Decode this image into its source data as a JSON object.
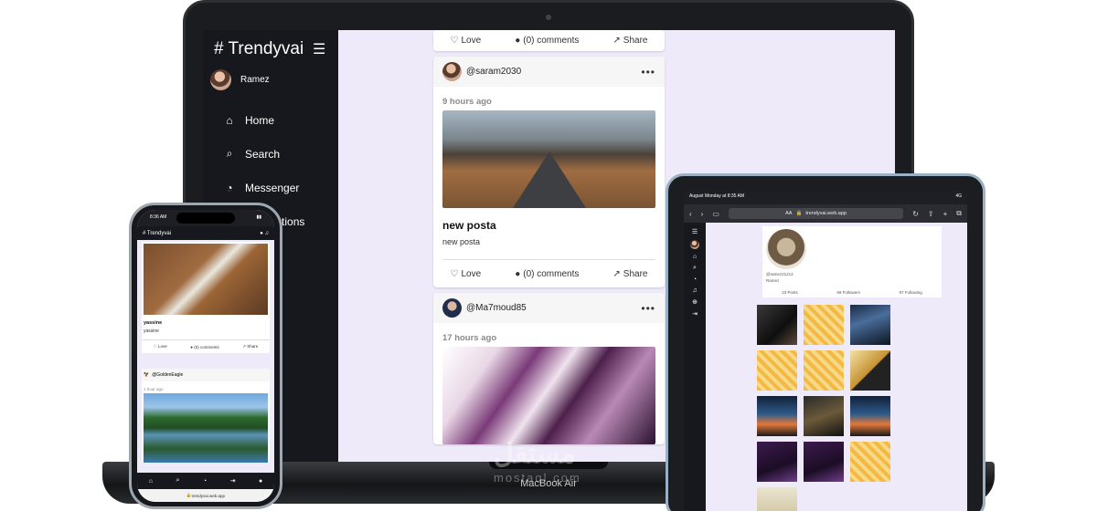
{
  "laptop": {
    "brand": "# Trendyvai",
    "menu_icon": "hamburger-icon",
    "user_name": "Ramez",
    "nav": [
      {
        "icon": "home-icon",
        "glyph": "⌂",
        "label": "Home"
      },
      {
        "icon": "search-icon",
        "glyph": "⌕",
        "label": "Search"
      },
      {
        "icon": "messenger-icon",
        "glyph": "◔",
        "label": "Messenger"
      },
      {
        "icon": "notifications-icon",
        "glyph": "♫",
        "label": "Notifications"
      }
    ],
    "actions": {
      "love": "Love",
      "comments": "(0) comments",
      "share": "Share"
    },
    "posts": [
      {
        "user": "@saram2030",
        "time": "9 hours ago",
        "title": "new posta",
        "body": "new posta"
      },
      {
        "user": "@Ma7moud85",
        "time": "17 hours ago"
      }
    ],
    "device_label": "MacBook Air",
    "watermark": "مستقل",
    "watermark_sub": "mostaql.com"
  },
  "tablet": {
    "status_left": "August Monday at 8:35 AM",
    "status_right": "4G",
    "url_prefix": "AA",
    "url": "trendyvai.web.app",
    "handle": "@ramez21212",
    "name": "Ramez",
    "stats": [
      "23 Posts",
      "69 Followers",
      "87 Following"
    ]
  },
  "phone": {
    "time": "8:36 AM",
    "brand": "# Trendyvai",
    "post1": {
      "title": "yassine",
      "body": "yassine"
    },
    "actions": {
      "love": "Love",
      "comments": "(0) comments",
      "share": "Share"
    },
    "post2": {
      "user": "@GoldenEagle",
      "time": "1 hour ago"
    },
    "url": "trendyvai.web.app"
  }
}
